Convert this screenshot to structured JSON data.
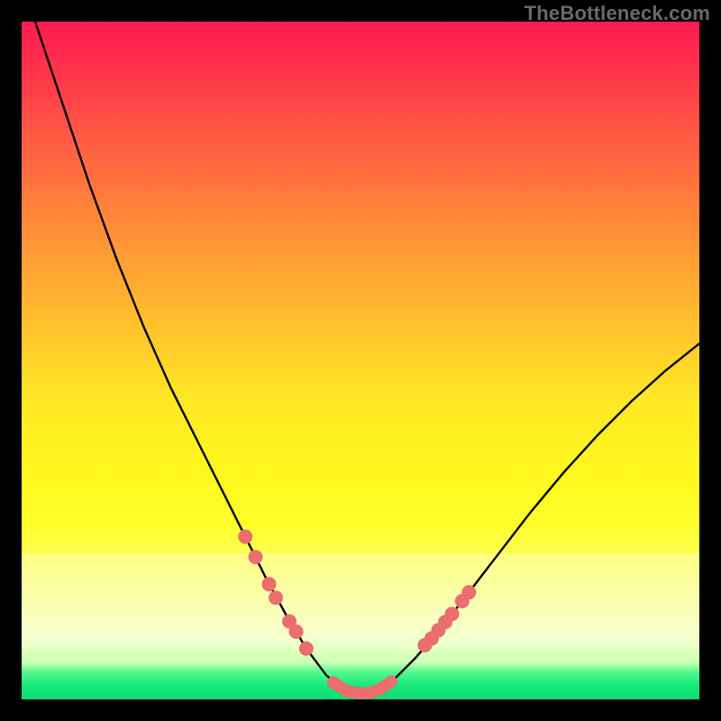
{
  "watermark": "TheBottleneck.com",
  "colors": {
    "background": "#000000",
    "curve": "#000000",
    "markers": "#ec6d6e",
    "grad_top": "#ff1a52",
    "grad_bottom": "#0fdc74"
  },
  "chart_data": {
    "type": "line",
    "title": "",
    "xlabel": "",
    "ylabel": "",
    "xlim": [
      0,
      100
    ],
    "ylim": [
      0,
      100
    ],
    "curve": [
      {
        "x": 2.0,
        "y": 100.0
      },
      {
        "x": 6.0,
        "y": 88.0
      },
      {
        "x": 10.0,
        "y": 76.0
      },
      {
        "x": 14.0,
        "y": 65.0
      },
      {
        "x": 18.0,
        "y": 55.0
      },
      {
        "x": 22.0,
        "y": 46.0
      },
      {
        "x": 26.0,
        "y": 38.0
      },
      {
        "x": 30.0,
        "y": 30.0
      },
      {
        "x": 33.0,
        "y": 24.0
      },
      {
        "x": 36.0,
        "y": 18.0
      },
      {
        "x": 39.0,
        "y": 12.5
      },
      {
        "x": 42.0,
        "y": 7.5
      },
      {
        "x": 45.0,
        "y": 3.5
      },
      {
        "x": 48.0,
        "y": 1.2
      },
      {
        "x": 50.0,
        "y": 0.8
      },
      {
        "x": 52.0,
        "y": 1.2
      },
      {
        "x": 55.0,
        "y": 3.0
      },
      {
        "x": 58.0,
        "y": 6.0
      },
      {
        "x": 61.5,
        "y": 10.0
      },
      {
        "x": 65.0,
        "y": 14.5
      },
      {
        "x": 70.0,
        "y": 21.0
      },
      {
        "x": 75.0,
        "y": 27.5
      },
      {
        "x": 80.0,
        "y": 33.5
      },
      {
        "x": 85.0,
        "y": 39.0
      },
      {
        "x": 90.0,
        "y": 44.0
      },
      {
        "x": 95.0,
        "y": 48.5
      },
      {
        "x": 100.0,
        "y": 52.5
      }
    ],
    "markers_left": [
      {
        "x": 33.0,
        "y": 24.0
      },
      {
        "x": 34.5,
        "y": 21.0
      },
      {
        "x": 36.5,
        "y": 17.0
      },
      {
        "x": 37.5,
        "y": 15.0
      },
      {
        "x": 39.5,
        "y": 11.5
      },
      {
        "x": 40.5,
        "y": 10.0
      },
      {
        "x": 42.0,
        "y": 7.5
      }
    ],
    "markers_bottom": [
      {
        "x": 46.0,
        "y": 2.5
      },
      {
        "x": 48.0,
        "y": 1.2
      },
      {
        "x": 50.0,
        "y": 0.9
      },
      {
        "x": 51.5,
        "y": 1.0
      },
      {
        "x": 53.0,
        "y": 1.6
      },
      {
        "x": 54.5,
        "y": 2.6
      }
    ],
    "markers_right": [
      {
        "x": 59.5,
        "y": 8.0
      },
      {
        "x": 60.5,
        "y": 9.0
      },
      {
        "x": 61.5,
        "y": 10.2
      },
      {
        "x": 62.5,
        "y": 11.4
      },
      {
        "x": 63.5,
        "y": 12.6
      },
      {
        "x": 65.0,
        "y": 14.5
      },
      {
        "x": 66.0,
        "y": 15.8
      }
    ]
  }
}
